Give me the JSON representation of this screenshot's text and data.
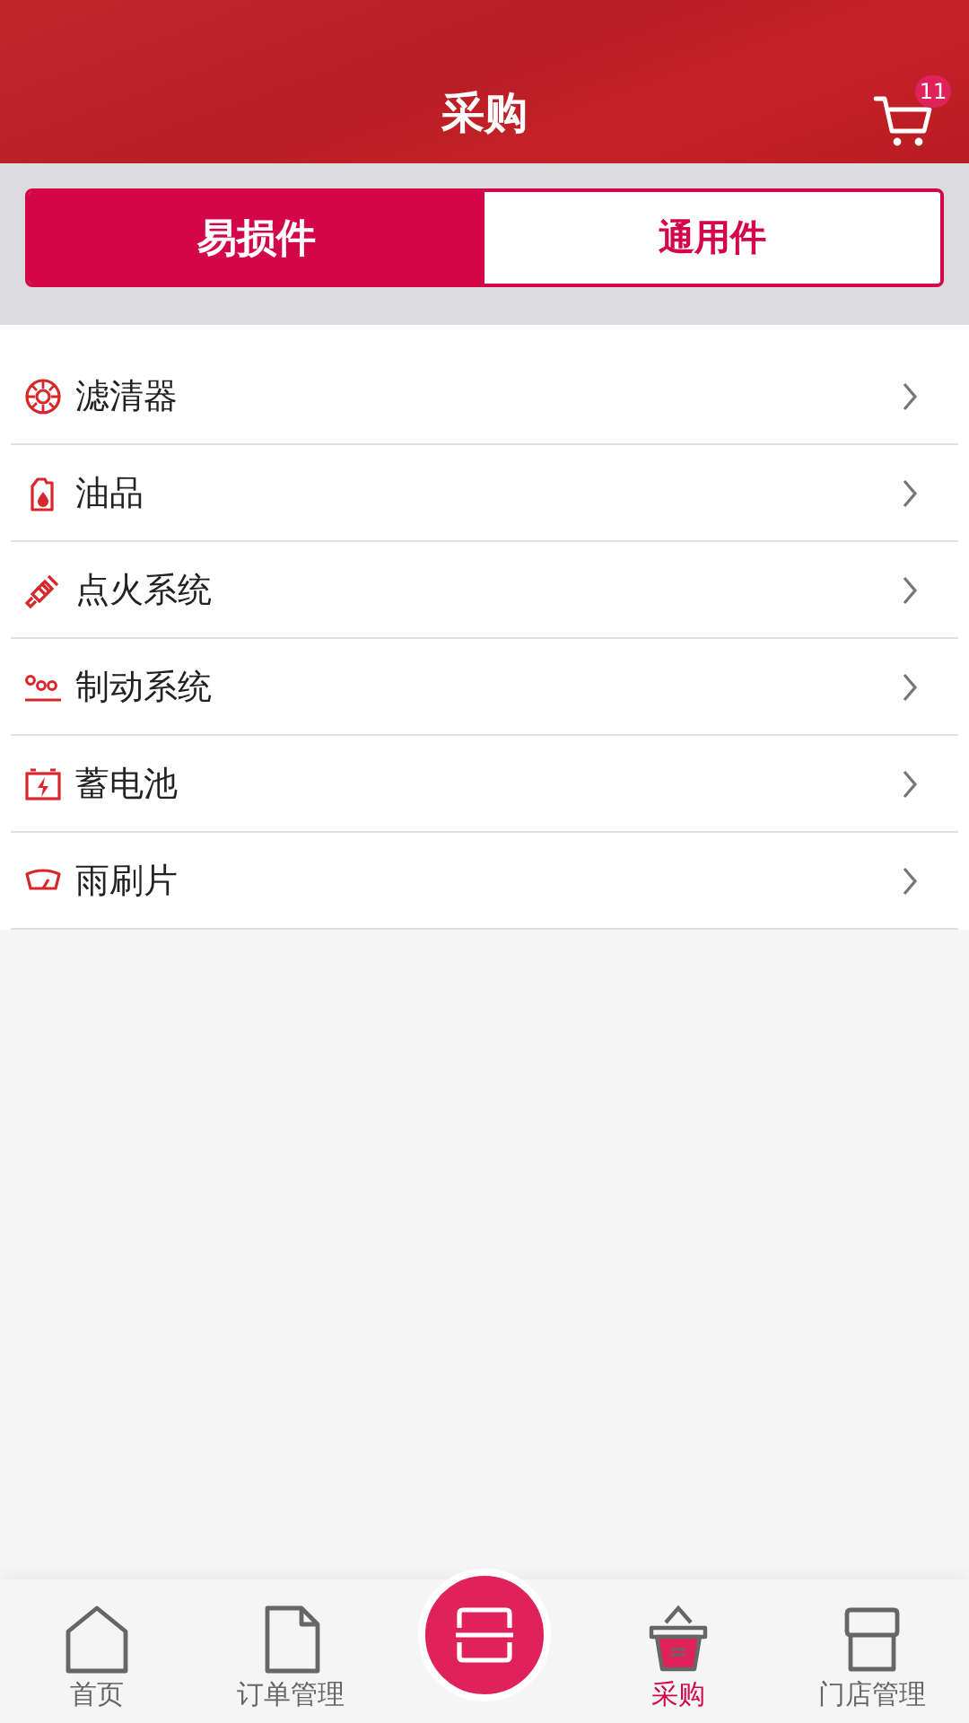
{
  "header": {
    "title": "采购",
    "cart_badge": "11"
  },
  "segments": [
    {
      "label": "易损件",
      "selected": true
    },
    {
      "label": "通用件",
      "selected": false
    }
  ],
  "categories": [
    {
      "label": "滤清器"
    },
    {
      "label": "油品"
    },
    {
      "label": "点火系统"
    },
    {
      "label": "制动系统"
    },
    {
      "label": "蓄电池"
    },
    {
      "label": "雨刷片"
    }
  ],
  "bottom_nav": [
    {
      "kind": "tab",
      "label": "首页",
      "selected": false
    },
    {
      "kind": "tab",
      "label": "订单管理",
      "selected": false
    },
    {
      "kind": "scan"
    },
    {
      "kind": "tab",
      "label": "采购",
      "selected": true
    },
    {
      "kind": "tab",
      "label": "门店管理",
      "selected": false
    }
  ]
}
